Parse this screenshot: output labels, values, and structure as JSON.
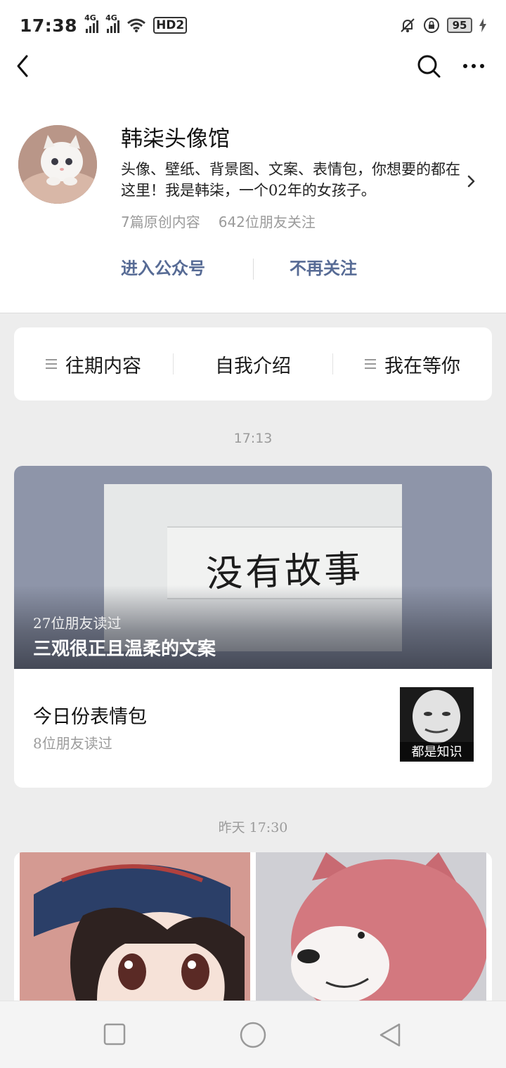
{
  "status_bar": {
    "time": "17:38",
    "signal1_label": "4G",
    "signal2_label": "4G",
    "hd_label": "HD2",
    "battery": "95"
  },
  "profile": {
    "name": "韩柒头像馆",
    "description": "头像、壁纸、背景图、文案、表情包，你想要的都在这里！我是韩柒，一个02年的女孩子。",
    "original_count": "7篇原创内容",
    "followers": "642位朋友关注",
    "enter_label": "进入公众号",
    "unfollow_label": "不再关注"
  },
  "menu": {
    "items": [
      {
        "label": "往期内容",
        "icon": "menu-lines-icon"
      },
      {
        "label": "自我介绍",
        "icon": ""
      },
      {
        "label": "我在等你",
        "icon": "menu-lines-icon"
      }
    ]
  },
  "feed": {
    "group1_time": "17:13",
    "main_article": {
      "cover_text": "没有故事",
      "readers": "27位朋友读过",
      "title": "三观很正且温柔的文案"
    },
    "sub_article": {
      "title": "今日份表情包",
      "readers": "8位朋友读过",
      "thumb_caption": "都是知识"
    },
    "group2_time": "昨天 17:30"
  },
  "colors": {
    "link": "#576b95",
    "background": "#ededed",
    "muted": "#9b9b9b"
  }
}
